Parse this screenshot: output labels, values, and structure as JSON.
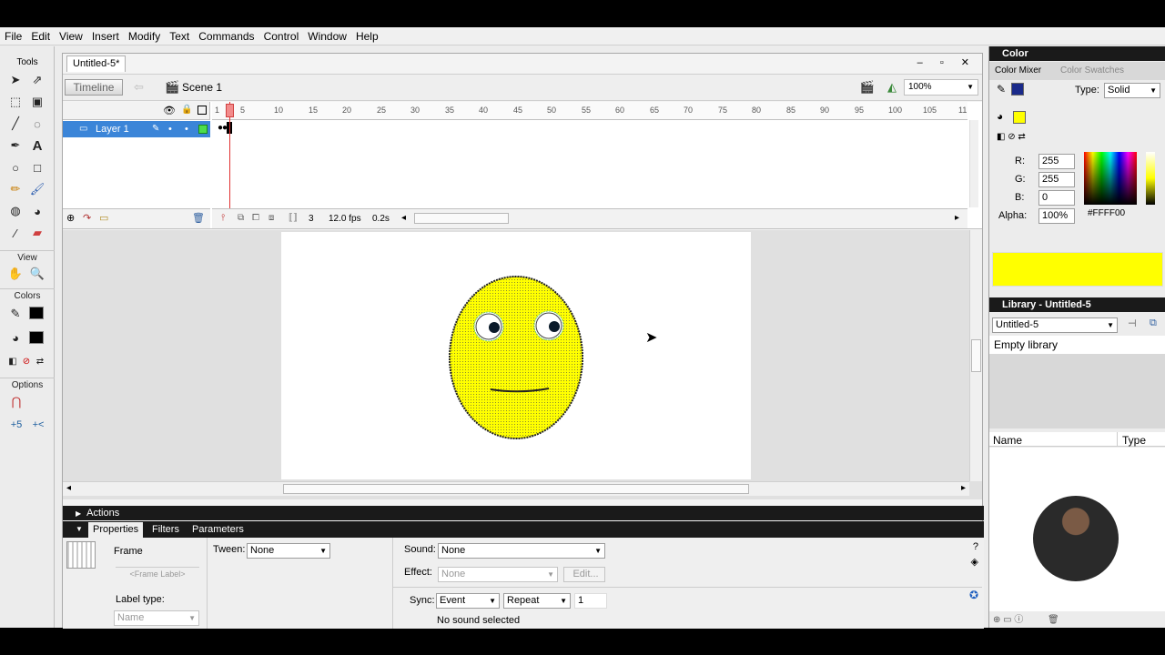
{
  "menubar": {
    "items": [
      "File",
      "Edit",
      "View",
      "Insert",
      "Modify",
      "Text",
      "Commands",
      "Control",
      "Window",
      "Help"
    ]
  },
  "tools": {
    "title": "Tools",
    "view_label": "View",
    "colors_label": "Colors",
    "options_label": "Options"
  },
  "document": {
    "tab": "Untitled-5*",
    "window_controls": "– ▫ ✕"
  },
  "editbar": {
    "timeline_button": "Timeline",
    "scene": "Scene 1",
    "zoom": "100%"
  },
  "timeline": {
    "layer_name": "Layer 1",
    "ruler": [
      "1",
      "5",
      "10",
      "15",
      "20",
      "25",
      "30",
      "35",
      "40",
      "45",
      "50",
      "55",
      "60",
      "65",
      "70",
      "75",
      "80",
      "85",
      "90",
      "95",
      "100",
      "105",
      "11"
    ],
    "current_frame": "3",
    "fps": "12.0 fps",
    "elapsed": "0.2s"
  },
  "panels": {
    "actions": "Actions",
    "tabs": [
      "Properties",
      "Filters",
      "Parameters"
    ]
  },
  "properties": {
    "frame_label": "Frame",
    "frame_label_placeholder": "<Frame Label>",
    "tween_label": "Tween:",
    "tween_value": "None",
    "label_type_label": "Label type:",
    "label_type_value": "Name",
    "sound_label": "Sound:",
    "sound_value": "None",
    "effect_label": "Effect:",
    "effect_value": "None",
    "edit_button": "Edit...",
    "sync_label": "Sync:",
    "sync_value": "Event",
    "repeat_value": "Repeat",
    "repeat_count": "1",
    "sound_status": "No sound selected"
  },
  "color_panel": {
    "header": "Color",
    "tab_mixer": "Color Mixer",
    "tab_swatches": "Color Swatches",
    "type_label": "Type:",
    "type_value": "Solid",
    "r_label": "R:",
    "r": "255",
    "g_label": "G:",
    "g": "255",
    "b_label": "B:",
    "b": "0",
    "alpha_label": "Alpha:",
    "alpha": "100%",
    "hex": "#FFFF00"
  },
  "library": {
    "header": "Library - Untitled-5",
    "selector": "Untitled-5",
    "status": "Empty library",
    "col_name": "Name",
    "col_type": "Type"
  },
  "colors": {
    "fill": "#FFFF00",
    "accent": "#3b85d8",
    "panel_dark": "#1a1a1a"
  }
}
